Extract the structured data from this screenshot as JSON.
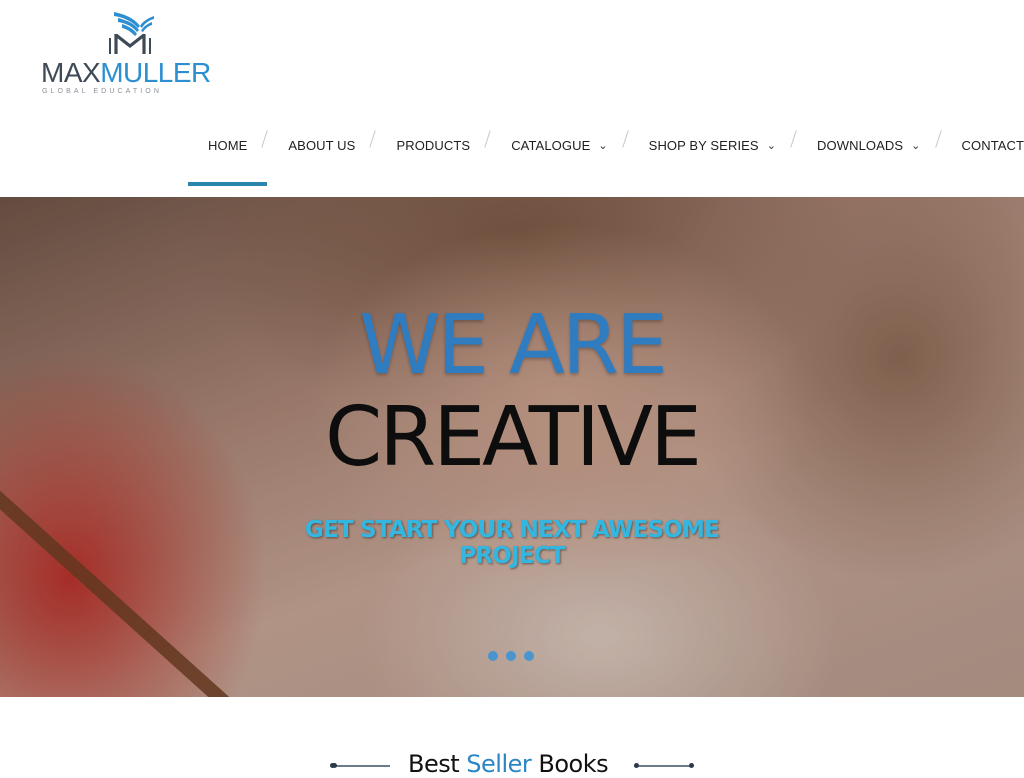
{
  "logo": {
    "word_max": "MAX",
    "word_muller": "MULLER",
    "tagline": "GLOBAL EDUCATION",
    "primary_color": "#2d8fd0",
    "secondary_color": "#3f4a57"
  },
  "nav": {
    "items": [
      {
        "label": "HOME",
        "active": true,
        "has_dropdown": false
      },
      {
        "label": "ABOUT US",
        "active": false,
        "has_dropdown": false
      },
      {
        "label": "PRODUCTS",
        "active": false,
        "has_dropdown": false
      },
      {
        "label": "CATALOGUE",
        "active": false,
        "has_dropdown": true
      },
      {
        "label": "SHOP BY SERIES",
        "active": false,
        "has_dropdown": true
      },
      {
        "label": "DOWNLOADS",
        "active": false,
        "has_dropdown": true
      },
      {
        "label": "CONTACT US",
        "active": false,
        "has_dropdown": false
      }
    ],
    "dropdown_icon": "chevron-down-icon",
    "active_color": "#2a86ad"
  },
  "hero": {
    "line1": "WE ARE",
    "line2": "CREATIVE",
    "subtitle": "GET START YOUR NEXT AWESOME PROJECT",
    "slide_count": 3,
    "line1_color": "#2f7cc0",
    "subtitle_color": "#33b6e0"
  },
  "best_seller": {
    "prefix": "Best ",
    "highlight": "Seller",
    "suffix": " Books",
    "highlight_color": "#2a86c6"
  }
}
